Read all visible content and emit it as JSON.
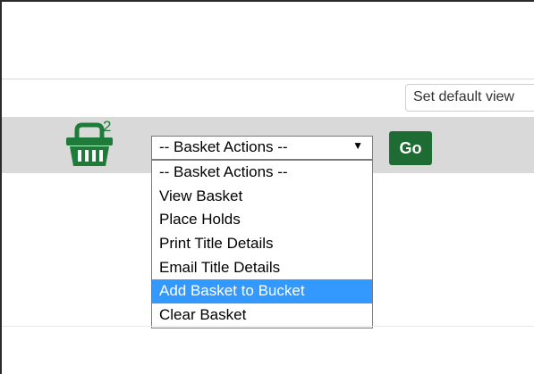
{
  "view_select": {
    "value": "Set default view"
  },
  "basket": {
    "count": "2"
  },
  "basket_actions": {
    "selected": "-- Basket Actions --",
    "options": [
      "-- Basket Actions --",
      "View Basket",
      "Place Holds",
      "Print Title Details",
      "Email Title Details",
      "Add Basket to Bucket",
      "Clear Basket"
    ],
    "highlighted_option": "Add Basket to Bucket"
  },
  "go_button": {
    "label": "Go"
  },
  "colors": {
    "toolbar": "#d9d9d9",
    "brand_green": "#1f6b34",
    "highlight": "#3399ff"
  }
}
